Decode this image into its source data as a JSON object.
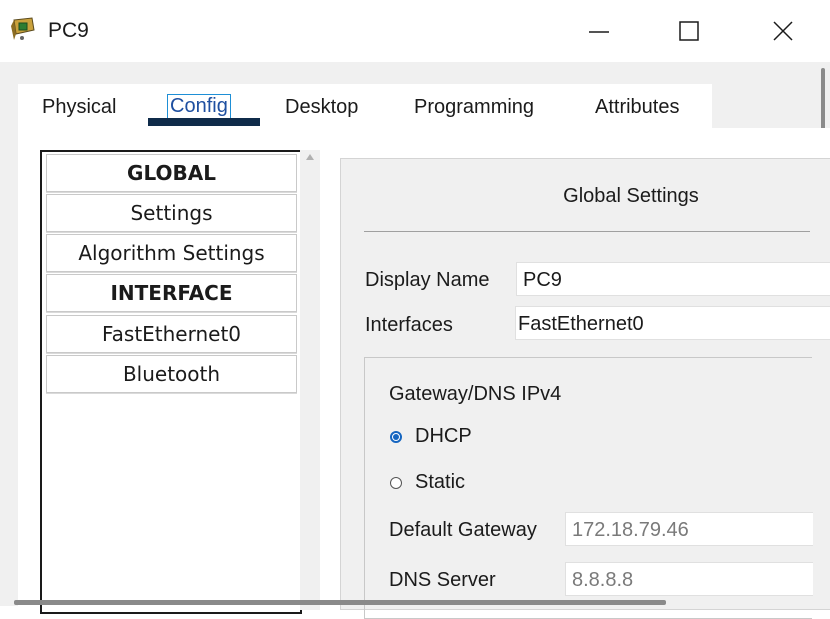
{
  "window": {
    "title": "PC9",
    "icon": "pc-device-icon"
  },
  "tabs": [
    {
      "label": "Physical",
      "active": false
    },
    {
      "label": "Config",
      "active": true
    },
    {
      "label": "Desktop",
      "active": false
    },
    {
      "label": "Programming",
      "active": false
    },
    {
      "label": "Attributes",
      "active": false
    }
  ],
  "nav": {
    "items": [
      {
        "label": "GLOBAL",
        "header": true
      },
      {
        "label": "Settings",
        "header": false
      },
      {
        "label": "Algorithm Settings",
        "header": false
      },
      {
        "label": "INTERFACE",
        "header": true
      },
      {
        "label": "FastEthernet0",
        "header": false
      },
      {
        "label": "Bluetooth",
        "header": false
      }
    ]
  },
  "settings": {
    "title": "Global Settings",
    "display_name_label": "Display Name",
    "display_name_value": "PC9",
    "interfaces_label": "Interfaces",
    "interfaces_value": "FastEthernet0",
    "gateway_dns_title": "Gateway/DNS IPv4",
    "dhcp_label": "DHCP",
    "static_label": "Static",
    "selected_mode": "DHCP",
    "default_gateway_label": "Default Gateway",
    "default_gateway_value": "172.18.79.46",
    "dns_server_label": "DNS Server",
    "dns_server_value": "8.8.8.8"
  },
  "colors": {
    "accent": "#1565c0",
    "tab_underline": "#0f2b4a",
    "panel_bg": "#f0f0f0"
  }
}
